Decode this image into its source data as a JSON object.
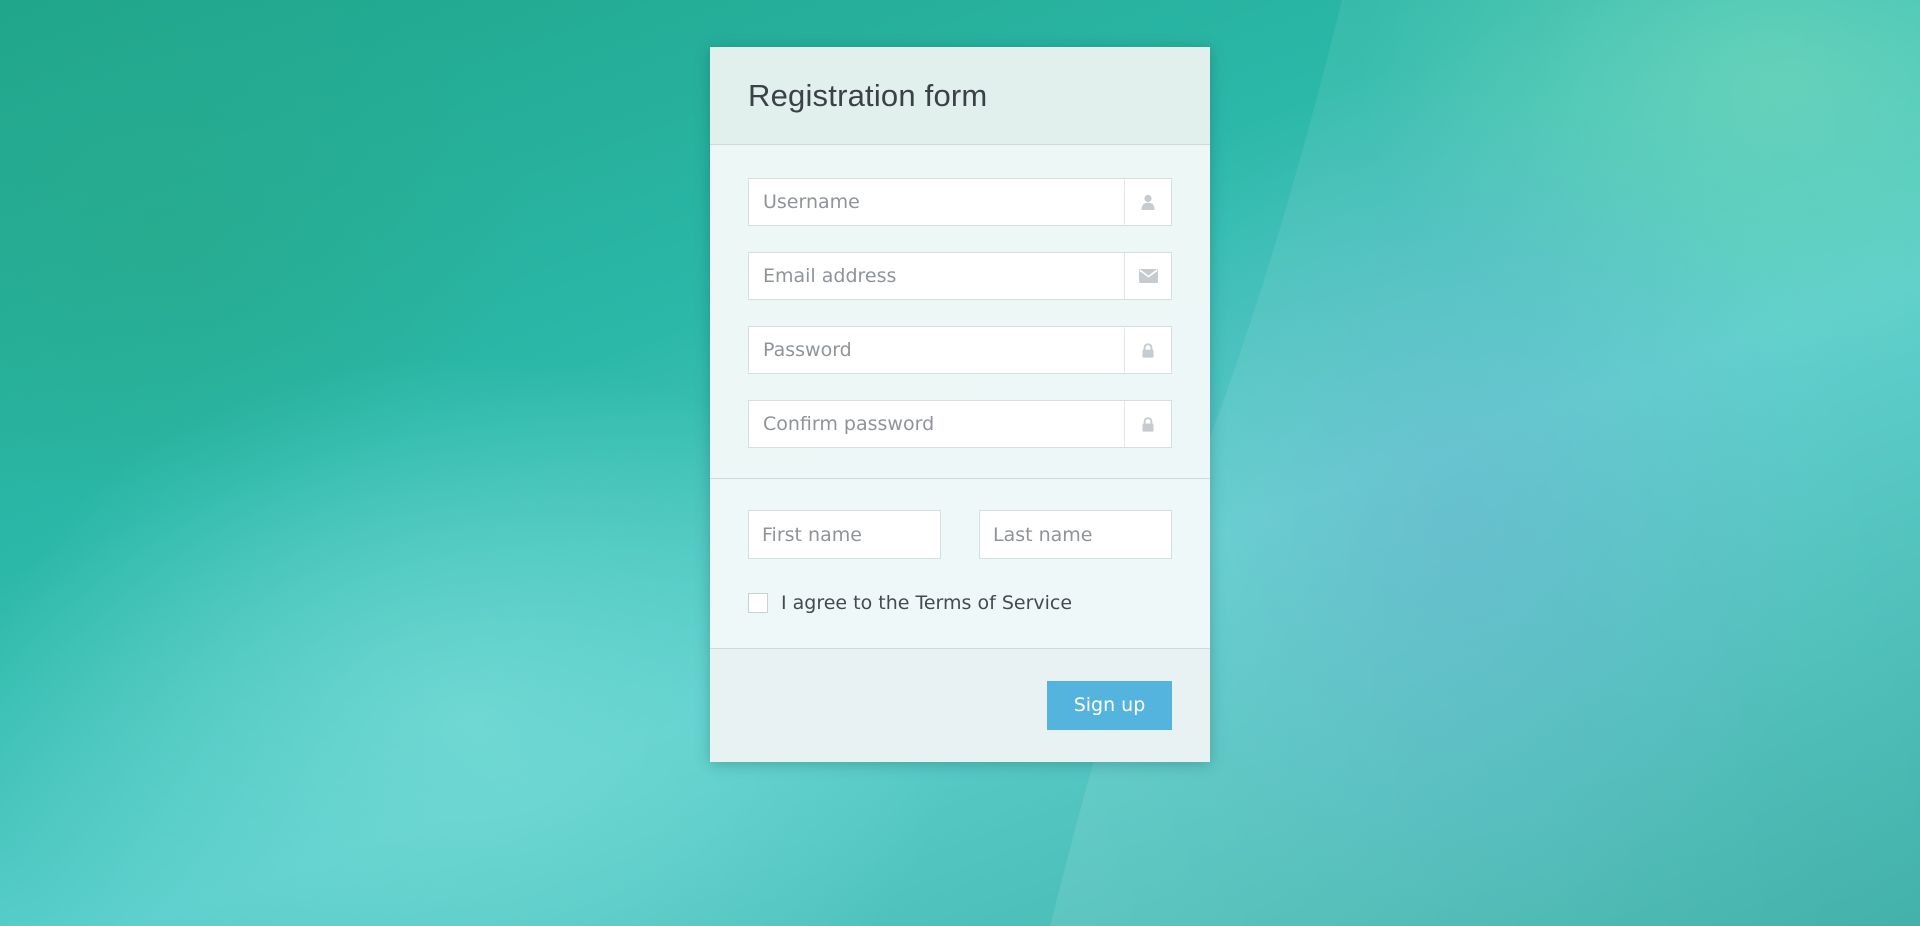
{
  "form": {
    "title": "Registration form",
    "fields": [
      {
        "placeholder": "Username",
        "icon": "user-icon"
      },
      {
        "placeholder": "Email address",
        "icon": "envelope-icon"
      },
      {
        "placeholder": "Password",
        "icon": "lock-icon"
      },
      {
        "placeholder": "Confirm password",
        "icon": "lock-icon"
      }
    ],
    "first_name_placeholder": "First name",
    "last_name_placeholder": "Last name",
    "terms_label": "I agree to the Terms of Service",
    "submit_label": "Sign up"
  },
  "colors": {
    "button": "#55b4dd",
    "icon": "#c6cbcf",
    "text": "#444a4f"
  }
}
